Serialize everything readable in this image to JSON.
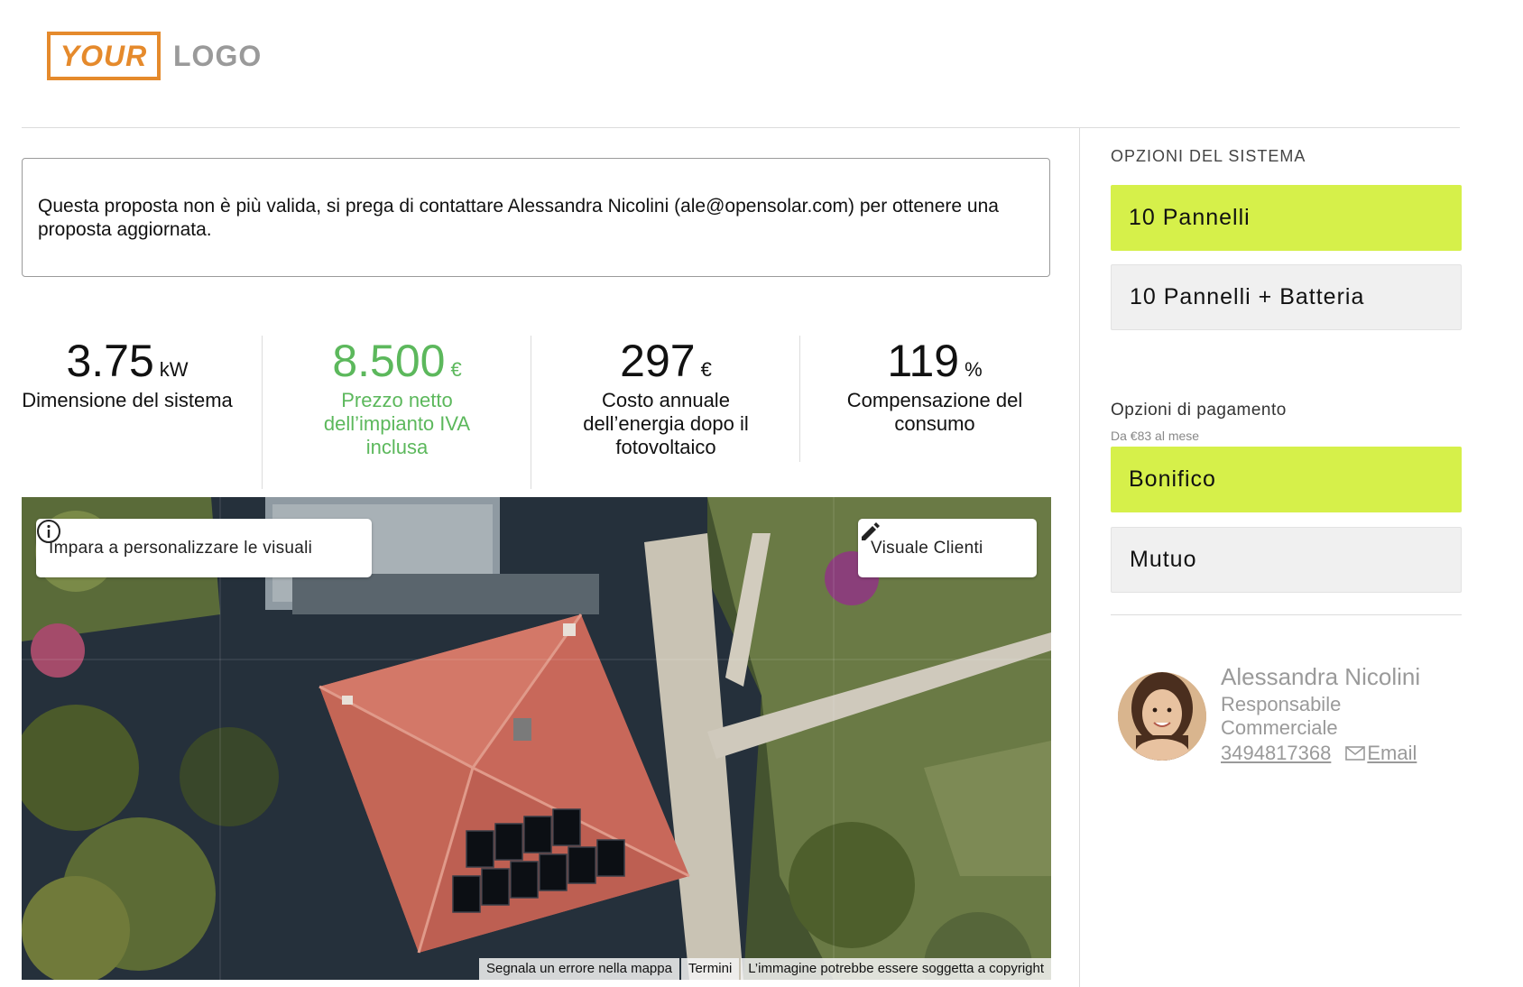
{
  "header": {
    "logo_your": "YOUR",
    "logo_logo": "LOGO"
  },
  "notice": {
    "text": "Questa proposta non è più valida, si prega di contattare Alessandra Nicolini (ale@opensolar.com) per ottenere una proposta aggiornata."
  },
  "stats": [
    {
      "value": "3.75",
      "unit": "kW",
      "label": "Dimensione del sistema"
    },
    {
      "value": "8.500",
      "unit": "€",
      "label": "Prezzo netto dell’impianto IVA inclusa"
    },
    {
      "value": "297",
      "unit": "€",
      "label": "Costo annuale dell’energia dopo il fotovoltaico"
    },
    {
      "value": "119",
      "unit": "%",
      "label": "Compensazione del consumo"
    }
  ],
  "map": {
    "learn_button": "Impara a personalizzare le visuali",
    "customer_view_button": "Visuale Clienti",
    "attribution": [
      "Segnala un errore nella mappa",
      "Termini",
      "L’immagine potrebbe essere soggetta a copyright"
    ]
  },
  "sidebar": {
    "system_options_title": "OPZIONI DEL SISTEMA",
    "system_options": [
      {
        "label": "10 Pannelli",
        "selected": true
      },
      {
        "label": "10 Pannelli + Batteria",
        "selected": false
      }
    ],
    "payment_title": "Opzioni di pagamento",
    "payment_subtitle": "Da €83 al mese",
    "payment_options": [
      {
        "label": "Bonifico",
        "selected": true
      },
      {
        "label": "Mutuo",
        "selected": false
      }
    ]
  },
  "contact": {
    "name": "Alessandra Nicolini",
    "role": "Responsabile Commerciale",
    "phone": "3494817368",
    "email_label": "Email"
  },
  "colors": {
    "accent_selected": "#d6f04a",
    "price_green": "#5cb85c",
    "logo_orange": "#e58a2c"
  }
}
